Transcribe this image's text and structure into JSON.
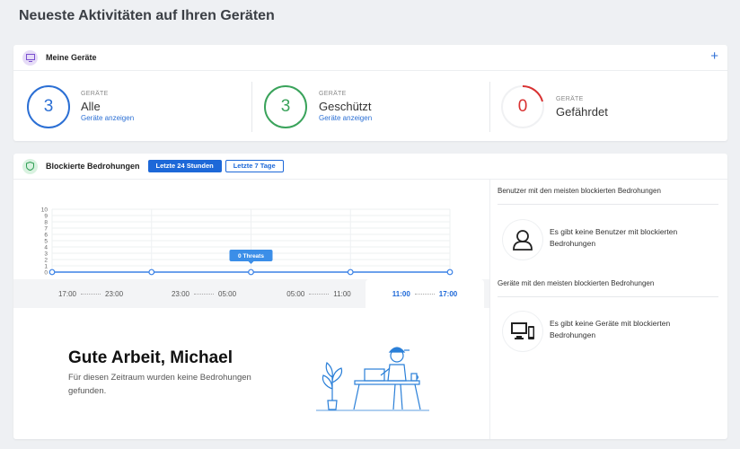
{
  "page": {
    "title": "Neueste Aktivitäten auf Ihren Geräten"
  },
  "devices": {
    "title": "Meine Geräte",
    "add_icon": "plus-icon",
    "stats": [
      {
        "count": "3",
        "label": "GERÄTE",
        "value": "Alle",
        "link": "Geräte anzeigen",
        "color": "#2b6fd4"
      },
      {
        "count": "3",
        "label": "GERÄTE",
        "value": "Geschützt",
        "link": "Geräte anzeigen",
        "color": "#3aa35b"
      },
      {
        "count": "0",
        "label": "GERÄTE",
        "value": "Gefährdet",
        "color": "#d93131"
      }
    ]
  },
  "threats": {
    "title": "Blockierte Bedrohungen",
    "tabs": [
      {
        "label": "Letzte 24 Stunden",
        "active": true
      },
      {
        "label": "Letzte 7 Tage",
        "active": false
      }
    ],
    "tooltip": "0 Threats",
    "ranges": [
      {
        "from": "17:00",
        "to": "23:00"
      },
      {
        "from": "23:00",
        "to": "05:00"
      },
      {
        "from": "05:00",
        "to": "11:00"
      },
      {
        "from": "11:00",
        "to": "17:00",
        "selected": true
      }
    ],
    "good_title": "Gute Arbeit, Michael",
    "good_text": "Für diesen Zeitraum wurden keine Bedrohungen gefunden."
  },
  "chart_data": {
    "type": "line",
    "x": [
      "17:00",
      "23:00",
      "05:00",
      "11:00",
      "17:00"
    ],
    "series": [
      {
        "values": [
          0,
          0,
          0,
          0,
          0
        ]
      }
    ],
    "y_ticks": [
      0,
      1,
      2,
      3,
      4,
      5,
      6,
      7,
      8,
      9,
      10
    ],
    "ylim": [
      0,
      10
    ],
    "grid": true,
    "line_color": "#3b82e6"
  },
  "side": {
    "users_heading": "Benutzer mit den meisten blockierten Bedrohungen",
    "users_empty": "Es gibt keine Benutzer mit blockierten Bedrohungen",
    "devices_heading": "Geräte mit den meisten blockierten Bedrohungen",
    "devices_empty": "Es gibt keine Geräte mit blockierten Bedrohungen"
  }
}
